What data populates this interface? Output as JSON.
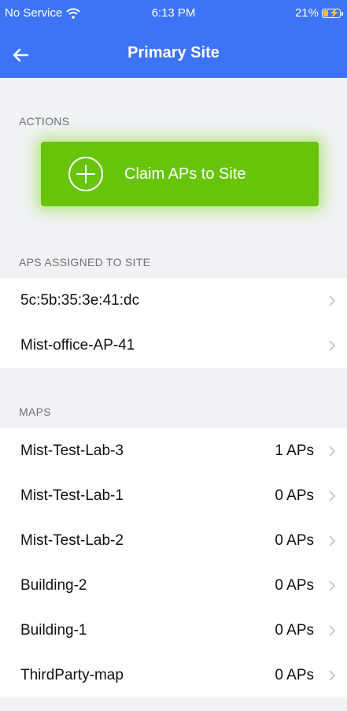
{
  "status_bar": {
    "carrier": "No Service",
    "time": "6:13 PM",
    "battery": "21%",
    "battery_level": 0.21,
    "icons": [
      "wifi-icon",
      "battery-charging-icon"
    ]
  },
  "nav": {
    "title": "Primary Site",
    "back_icon": "arrow-left-icon"
  },
  "actions": {
    "section_label": "ACTIONS",
    "claim_button_label": "Claim APs to Site",
    "claim_icon": "plus-circle-icon",
    "accent_color": "#67c40a"
  },
  "aps": {
    "section_label": "APS ASSIGNED TO SITE",
    "items": [
      {
        "label": "5c:5b:35:3e:41:dc"
      },
      {
        "label": "Mist-office-AP-41"
      }
    ]
  },
  "maps": {
    "section_label": "MAPS",
    "items": [
      {
        "label": "Mist-Test-Lab-3",
        "count": "1 APs"
      },
      {
        "label": "Mist-Test-Lab-1",
        "count": "0 APs"
      },
      {
        "label": "Mist-Test-Lab-2",
        "count": "0 APs"
      },
      {
        "label": "Building-2",
        "count": "0 APs"
      },
      {
        "label": "Building-1",
        "count": "0 APs"
      },
      {
        "label": "ThirdParty-map",
        "count": "0 APs"
      }
    ]
  },
  "colors": {
    "header_blue": "#3d74f5",
    "background": "#f2f2f4",
    "chevron": "#c4c4c8"
  }
}
